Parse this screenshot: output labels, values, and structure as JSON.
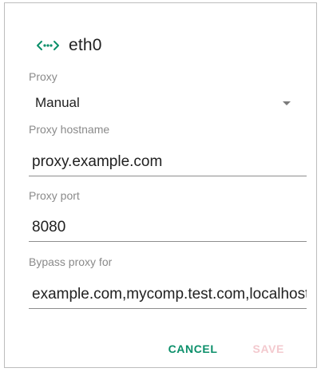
{
  "dialog": {
    "title": "eth0",
    "icon": "ethernet-icon",
    "accent_color": "#0b8f6a"
  },
  "proxy": {
    "label": "Proxy",
    "selected": "Manual"
  },
  "hostname": {
    "label": "Proxy hostname",
    "value": "proxy.example.com"
  },
  "port": {
    "label": "Proxy port",
    "value": "8080"
  },
  "bypass": {
    "label": "Bypass proxy for",
    "value": "example.com,mycomp.test.com,localhost"
  },
  "actions": {
    "cancel_label": "CANCEL",
    "save_label": "SAVE",
    "save_enabled": false
  }
}
